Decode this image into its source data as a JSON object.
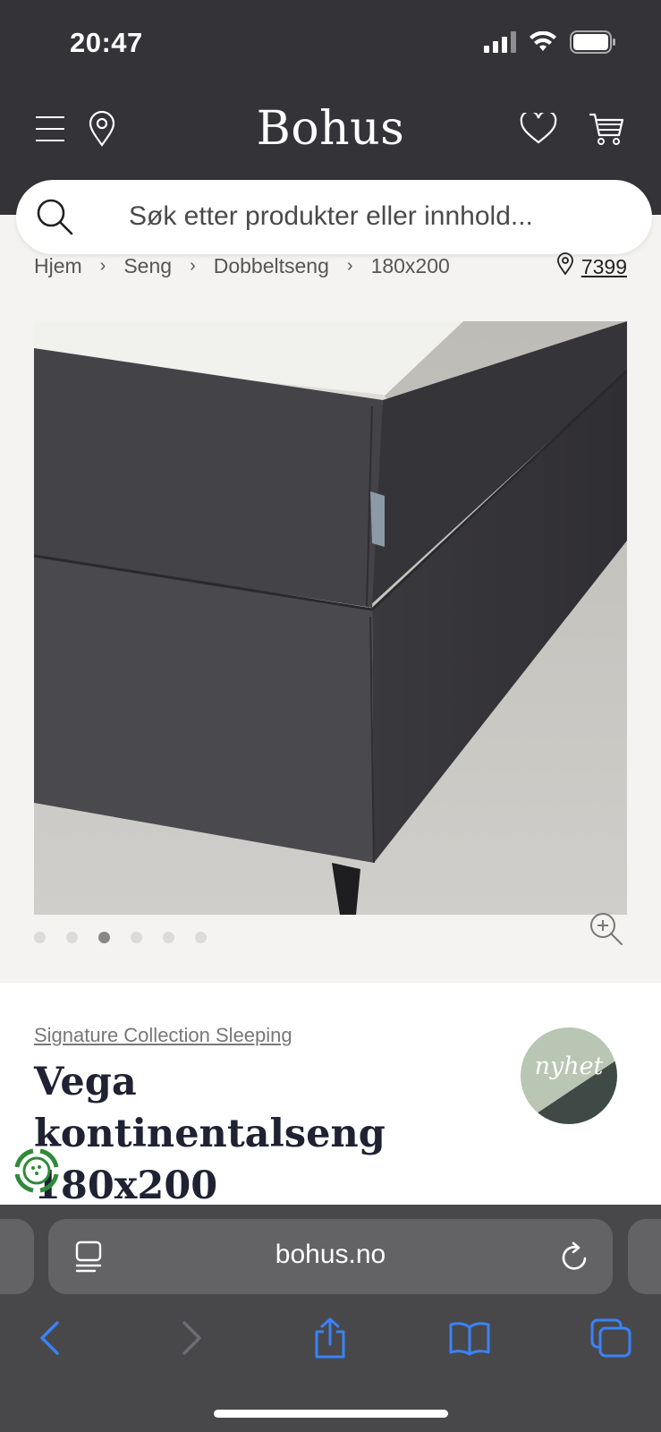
{
  "status_bar": {
    "time": "20:47",
    "icons": [
      "cellular-signal-icon",
      "wifi-icon",
      "battery-icon"
    ]
  },
  "header": {
    "logo": "Bohus",
    "icons": [
      "menu-icon",
      "location-pin-icon",
      "heart-icon",
      "cart-icon"
    ]
  },
  "search": {
    "placeholder": "Søk etter produkter eller innhold..."
  },
  "breadcrumb": {
    "items": [
      "Hjem",
      "Seng",
      "Dobbeltseng",
      "180x200"
    ],
    "separator": "›"
  },
  "store": {
    "code": "7399"
  },
  "gallery": {
    "total_images": 6,
    "active_index": 2
  },
  "product": {
    "brand": "Signature Collection Sleeping",
    "title": "Vega kontinentalseng 180x200",
    "badge": "nyhet"
  },
  "safari": {
    "url": "bohus.no"
  },
  "colors": {
    "header_bg": "#333338",
    "page_bg": "#f4f3f1",
    "title_color": "#1f2233",
    "badge_light": "#b9c6b3",
    "badge_dark": "#3f4a46",
    "safari_accent": "#3a82f7",
    "loader_green": "#2e8b3a"
  }
}
